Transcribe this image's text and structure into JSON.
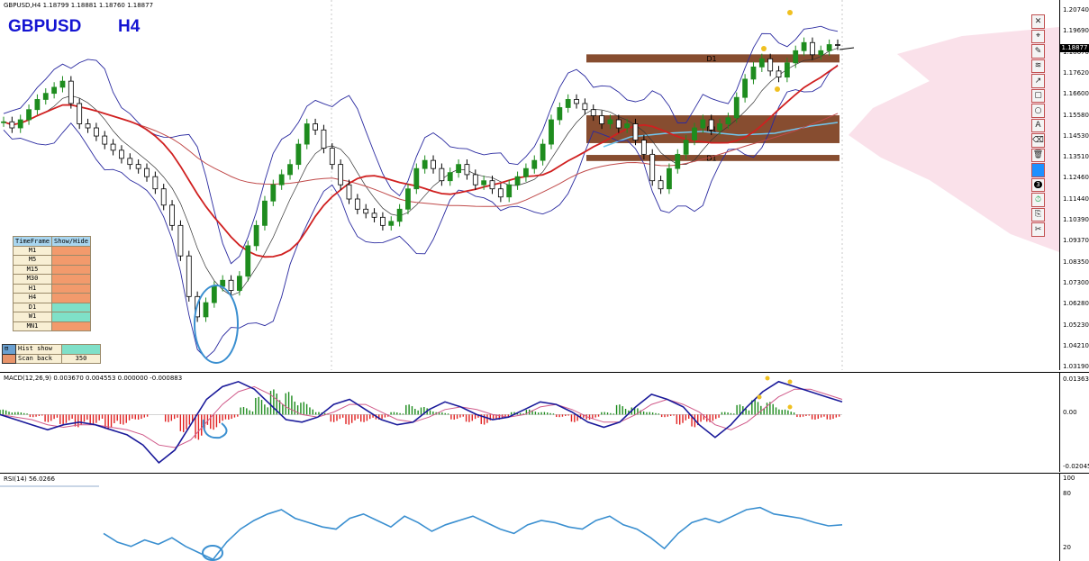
{
  "header": {
    "ohlc_text": "GBPUSD,H4  1.18799 1.18881 1.18760 1.18877",
    "symbol": "GBPUSD",
    "timeframe": "H4"
  },
  "colors": {
    "bull_candle": "#1e8c1e",
    "bear_candle": "#000000",
    "bollinger": "#2a2aa0",
    "ma_fast": "#8b0000",
    "ma_red": "#d02020",
    "ma_slow": "#c04a4a",
    "zone": "#7a3a1a",
    "macd_up": "#1b8a1b",
    "macd_down": "#e02020",
    "macd_line": "#1a1a9a",
    "signal_line": "#d05a8a",
    "rsi": "#3a8fd0",
    "circle": "#3a8fd0",
    "marker": "#f0c020",
    "symbol_text": "#1414d2"
  },
  "main_axis": {
    "ticks": [
      "1.20740",
      "1.19690",
      "1.18670",
      "1.17620",
      "1.16600",
      "1.15580",
      "1.14530",
      "1.13510",
      "1.12460",
      "1.11440",
      "1.10390",
      "1.09370",
      "1.08350",
      "1.07300",
      "1.06280",
      "1.05230",
      "1.04210",
      "1.03190"
    ],
    "current_price": "1.18877"
  },
  "zones": [
    {
      "label": "D1"
    },
    {
      "label": "D1"
    },
    {
      "label": "D1"
    }
  ],
  "macd": {
    "title": "MACD(12,26,9) 0.003670 0.004553 0.000000 -0.000883",
    "ticks": [
      "0.013632",
      "0.00",
      "-0.020451"
    ]
  },
  "rsi": {
    "title": "RSI(14) 56.0266",
    "ticks": [
      "100",
      "80",
      "20"
    ]
  },
  "timeframe_panel": {
    "headers": [
      "TimeFrame",
      "Show/Hide"
    ],
    "rows": [
      {
        "name": "M1",
        "state": "hide"
      },
      {
        "name": "M5",
        "state": "hide"
      },
      {
        "name": "M15",
        "state": "hide"
      },
      {
        "name": "M30",
        "state": "hide"
      },
      {
        "name": "H1",
        "state": "hide"
      },
      {
        "name": "H4",
        "state": "hide"
      },
      {
        "name": "D1",
        "state": "show"
      },
      {
        "name": "W1",
        "state": "show"
      },
      {
        "name": "MN1",
        "state": "hide"
      }
    ],
    "hist_show_label": "Hist show",
    "scan_back_label": "Scan back",
    "scan_back_value": "350"
  },
  "toolbar": {
    "buttons": [
      {
        "icon": "close-icon",
        "glyph": "✕"
      },
      {
        "icon": "pin-icon",
        "glyph": "⌖"
      },
      {
        "icon": "pencil-icon",
        "glyph": "✎"
      },
      {
        "icon": "wave-icon",
        "glyph": "≋"
      },
      {
        "icon": "arrow-icon",
        "glyph": "↗"
      },
      {
        "icon": "rectangle-icon",
        "glyph": "▢"
      },
      {
        "icon": "ellipse-icon",
        "glyph": "○"
      },
      {
        "icon": "text-icon",
        "glyph": "A"
      },
      {
        "icon": "eraser-icon",
        "glyph": "⌫"
      },
      {
        "icon": "trash-icon",
        "glyph": "🗑"
      },
      {
        "icon": "color-swatch-icon",
        "glyph": ""
      },
      {
        "icon": "width-icon",
        "glyph": "3"
      },
      {
        "icon": "clock-icon",
        "glyph": "⏱"
      },
      {
        "icon": "save-icon",
        "glyph": "⎘"
      },
      {
        "icon": "scissors-icon",
        "glyph": "✂"
      }
    ]
  },
  "chart_data": {
    "type": "line",
    "symbol": "GBPUSD",
    "timeframe": "H4",
    "ylim": [
      1.0319,
      1.2074
    ],
    "close_series": [
      1.151,
      1.148,
      1.152,
      1.157,
      1.162,
      1.165,
      1.168,
      1.171,
      1.16,
      1.15,
      1.148,
      1.144,
      1.14,
      1.137,
      1.133,
      1.13,
      1.128,
      1.124,
      1.118,
      1.11,
      1.1,
      1.085,
      1.065,
      1.055,
      1.062,
      1.07,
      1.073,
      1.068,
      1.075,
      1.09,
      1.1,
      1.112,
      1.12,
      1.125,
      1.13,
      1.14,
      1.15,
      1.147,
      1.138,
      1.13,
      1.12,
      1.113,
      1.108,
      1.106,
      1.104,
      1.1,
      1.102,
      1.108,
      1.118,
      1.128,
      1.132,
      1.128,
      1.122,
      1.126,
      1.13,
      1.125,
      1.12,
      1.122,
      1.118,
      1.114,
      1.12,
      1.124,
      1.128,
      1.132,
      1.14,
      1.152,
      1.158,
      1.162,
      1.16,
      1.157,
      1.154,
      1.15,
      1.152,
      1.148,
      1.15,
      1.142,
      1.135,
      1.122,
      1.118,
      1.128,
      1.135,
      1.142,
      1.148,
      1.152,
      1.147,
      1.15,
      1.153,
      1.163,
      1.172,
      1.178,
      1.182,
      1.176,
      1.173,
      1.18,
      1.186,
      1.19,
      1.184,
      1.186,
      1.189,
      1.18877
    ],
    "zones": [
      {
        "label": "D1",
        "high": 1.1842,
        "low": 1.1802
      },
      {
        "label": "D1",
        "high": 1.1542,
        "low": 1.1405
      },
      {
        "label": "D1",
        "high": 1.1347,
        "low": 1.1317
      }
    ],
    "macd": {
      "ylim": [
        -0.020451,
        0.013632
      ],
      "hist": [
        0.002,
        0.001,
        -0.001,
        -0.003,
        -0.004,
        -0.005,
        -0.004,
        -0.006,
        -0.004,
        -0.002,
        0.0,
        -0.003,
        -0.007,
        -0.01,
        -0.006,
        -0.002,
        0.003,
        0.007,
        0.01,
        0.009,
        0.005,
        0.001,
        -0.003,
        -0.004,
        -0.003,
        -0.002,
        0.001,
        0.004,
        0.003,
        0.001,
        -0.002,
        -0.003,
        -0.004,
        -0.002,
        0.001,
        0.002,
        0.001,
        -0.001,
        -0.003,
        -0.002,
        0.001,
        0.004,
        0.003,
        0.001,
        -0.001,
        -0.004,
        -0.005,
        -0.003,
        0.001,
        0.004,
        0.006,
        0.005,
        0.002,
        -0.001,
        -0.002,
        -0.002
      ],
      "macd_line": [
        0.0,
        -0.002,
        -0.004,
        -0.006,
        -0.004,
        -0.003,
        -0.004,
        -0.006,
        -0.008,
        -0.012,
        -0.019,
        -0.014,
        -0.004,
        0.006,
        0.011,
        0.013,
        0.01,
        0.004,
        -0.002,
        -0.003,
        -0.001,
        0.004,
        0.006,
        0.002,
        -0.002,
        -0.004,
        -0.003,
        0.002,
        0.005,
        0.003,
        0.0,
        -0.002,
        -0.001,
        0.002,
        0.005,
        0.004,
        0.001,
        -0.003,
        -0.005,
        -0.003,
        0.003,
        0.008,
        0.006,
        0.003,
        -0.004,
        -0.009,
        -0.004,
        0.003,
        0.009,
        0.013,
        0.011,
        0.009,
        0.007,
        0.005
      ],
      "signal_line": [
        0.0,
        -0.001,
        -0.002,
        -0.004,
        -0.005,
        -0.004,
        -0.004,
        -0.005,
        -0.006,
        -0.008,
        -0.012,
        -0.013,
        -0.01,
        -0.003,
        0.004,
        0.009,
        0.011,
        0.008,
        0.003,
        0.0,
        -0.001,
        0.001,
        0.004,
        0.004,
        0.001,
        -0.002,
        -0.003,
        -0.001,
        0.002,
        0.003,
        0.002,
        0.0,
        -0.001,
        0.0,
        0.003,
        0.004,
        0.002,
        -0.001,
        -0.003,
        -0.003,
        0.0,
        0.004,
        0.006,
        0.004,
        0.001,
        -0.004,
        -0.006,
        -0.003,
        0.002,
        0.007,
        0.01,
        0.01,
        0.008,
        0.006
      ]
    },
    "rsi": {
      "ylim": [
        0,
        100
      ],
      "values": [
        48,
        40,
        36,
        42,
        38,
        44,
        36,
        30,
        24,
        40,
        52,
        60,
        66,
        70,
        62,
        58,
        54,
        52,
        62,
        66,
        60,
        54,
        64,
        58,
        50,
        56,
        60,
        64,
        58,
        52,
        48,
        56,
        60,
        58,
        54,
        52,
        60,
        64,
        56,
        52,
        44,
        34,
        48,
        58,
        62,
        58,
        64,
        70,
        72,
        66,
        64,
        62,
        58,
        55,
        56
      ]
    }
  }
}
